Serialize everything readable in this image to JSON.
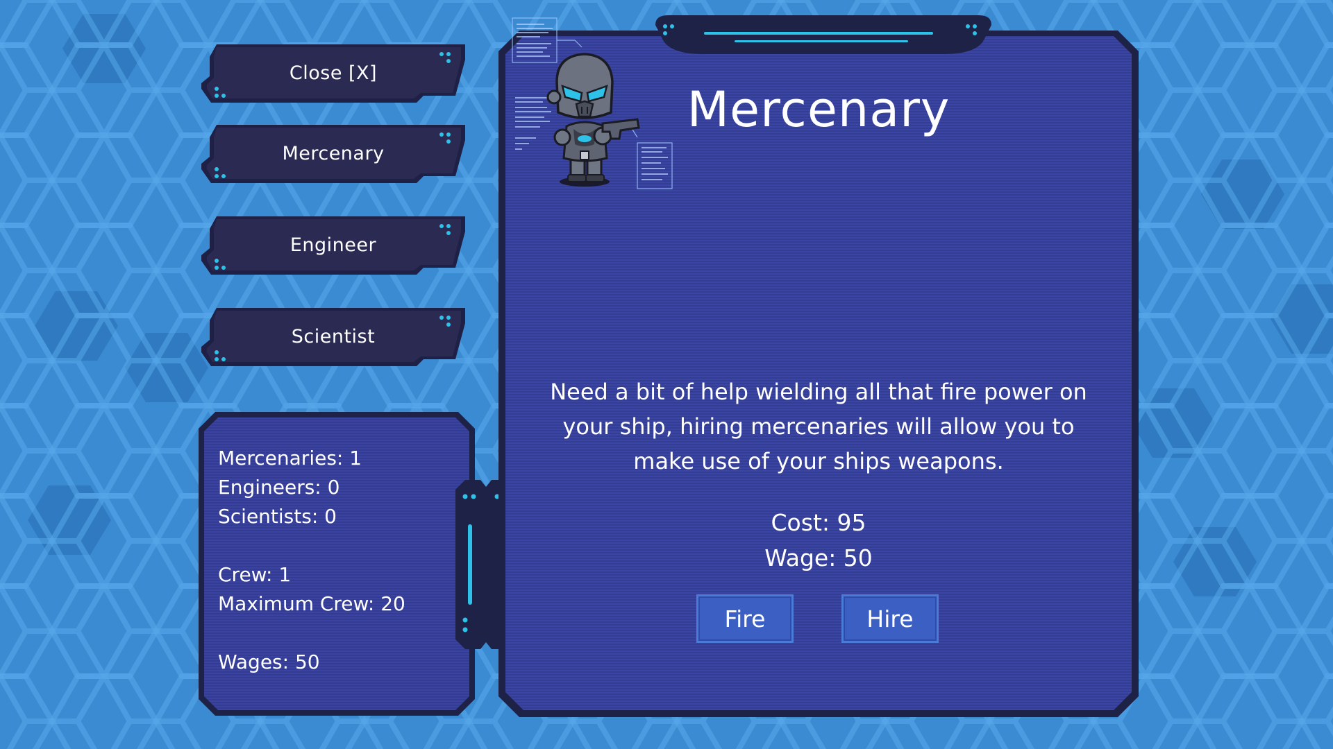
{
  "menu": {
    "close_label": "Close [X]",
    "mercenary_label": "Mercenary",
    "engineer_label": "Engineer",
    "scientist_label": "Scientist"
  },
  "stats": {
    "mercenaries": "Mercenaries: 1",
    "engineers": "Engineers: 0",
    "scientists": "Scientists: 0",
    "crew": "Crew: 1",
    "max_crew": "Maximum Crew: 20",
    "wages": "Wages: 50"
  },
  "detail": {
    "title": "Mercenary",
    "description": "Need a bit of help wielding all that fire power on your ship, hiring mercenaries will allow you to make use of your ships weapons.",
    "cost": "Cost: 95",
    "wage": "Wage: 50",
    "fire_label": "Fire",
    "hire_label": "Hire"
  },
  "colors": {
    "background": "#3d8fd6",
    "panel": "#363f96",
    "panel_border": "#1e2247",
    "button_dark": "#25254a",
    "accent_cyan": "#2fc2e8",
    "action_button": "#3c5fc3"
  },
  "icons": {
    "portrait": "mercenary-robot-icon"
  }
}
